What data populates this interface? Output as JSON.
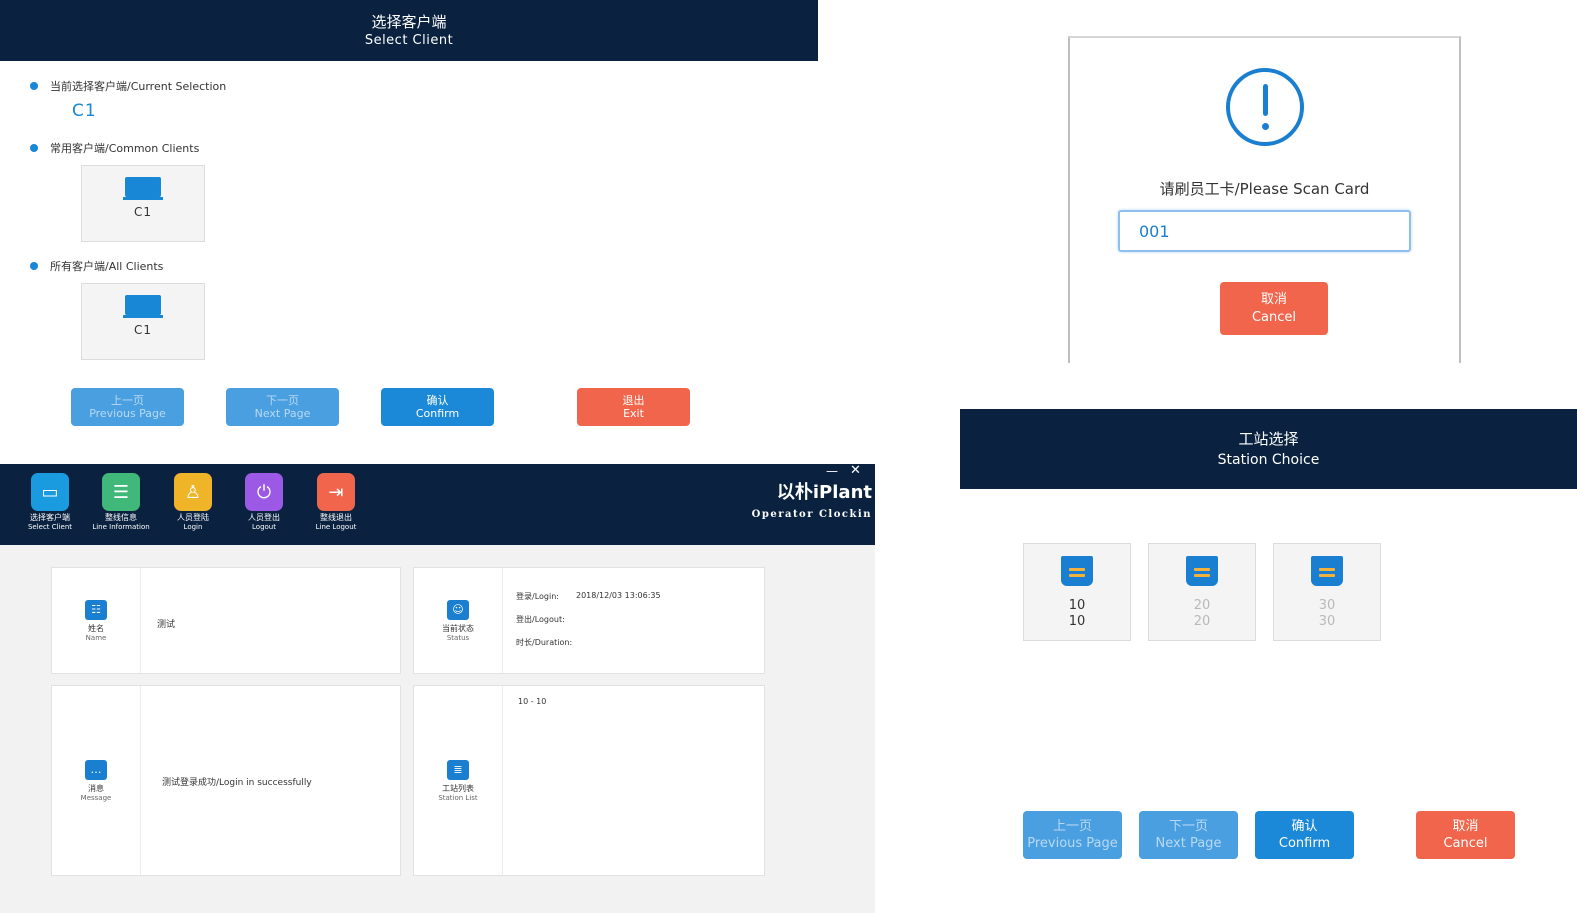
{
  "select_client": {
    "title_cn": "选择客户端",
    "title_en": "Select Client",
    "current_label": "当前选择客户端/Current Selection",
    "current_value": "C1",
    "common_label": "常用客户端/Common Clients",
    "common_clients": [
      "C1"
    ],
    "all_label": "所有客户端/All Clients",
    "all_clients": [
      "C1"
    ],
    "buttons": {
      "prev_cn": "上一页",
      "prev_en": "Previous Page",
      "next_cn": "下一页",
      "next_en": "Next Page",
      "confirm_cn": "确认",
      "confirm_en": "Confirm",
      "exit_cn": "退出",
      "exit_en": "Exit"
    }
  },
  "scan_dialog": {
    "title": "请刷员工卡/Please Scan Card",
    "input_value": "001",
    "cancel_cn": "取消",
    "cancel_en": "Cancel"
  },
  "clockin": {
    "toolbar": [
      {
        "cn": "选择客户端",
        "en": "Select Client",
        "icon": "laptop-icon",
        "color": "#1a9be0"
      },
      {
        "cn": "整线信息",
        "en": "Line Information",
        "icon": "list-icon",
        "color": "#3fb87a"
      },
      {
        "cn": "人员登陆",
        "en": "Login",
        "icon": "user-icon",
        "color": "#f0b429"
      },
      {
        "cn": "人员登出",
        "en": "Logout",
        "icon": "power-icon",
        "color": "#9b59e6"
      },
      {
        "cn": "整线退出",
        "en": "Line Logout",
        "icon": "exit-icon",
        "color": "#f0654b"
      }
    ],
    "brand_name": "以朴iPlant",
    "brand_sub": "Operator Clockin",
    "name_card": {
      "label_cn": "姓名",
      "label_en": "Name",
      "value": "测试"
    },
    "status_card": {
      "label_cn": "当前状态",
      "label_en": "Status",
      "login_label": "登录/Login:",
      "login_value": "2018/12/03 13:06:35",
      "logout_label": "登出/Logout:",
      "duration_label": "时长/Duration:"
    },
    "message_card": {
      "label_cn": "消息",
      "label_en": "Message",
      "value": "测试登录成功/Login in successfully"
    },
    "station_card": {
      "label_cn": "工站列表",
      "label_en": "Station List",
      "value": "10 - 10"
    }
  },
  "station_choice": {
    "title_cn": "工站选择",
    "title_en": "Station Choice",
    "stations": [
      {
        "line1": "10",
        "line2": "10",
        "enabled": true
      },
      {
        "line1": "20",
        "line2": "20",
        "enabled": false
      },
      {
        "line1": "30",
        "line2": "30",
        "enabled": false
      }
    ],
    "buttons": {
      "prev_cn": "上一页",
      "prev_en": "Previous Page",
      "next_cn": "下一页",
      "next_en": "Next Page",
      "confirm_cn": "确认",
      "confirm_en": "Confirm",
      "cancel_cn": "取消",
      "cancel_en": "Cancel"
    }
  },
  "colors": {
    "navy": "#0a2240",
    "blue": "#1b88d8",
    "red": "#f0654b",
    "tray_stripe": "#f2b13d"
  }
}
